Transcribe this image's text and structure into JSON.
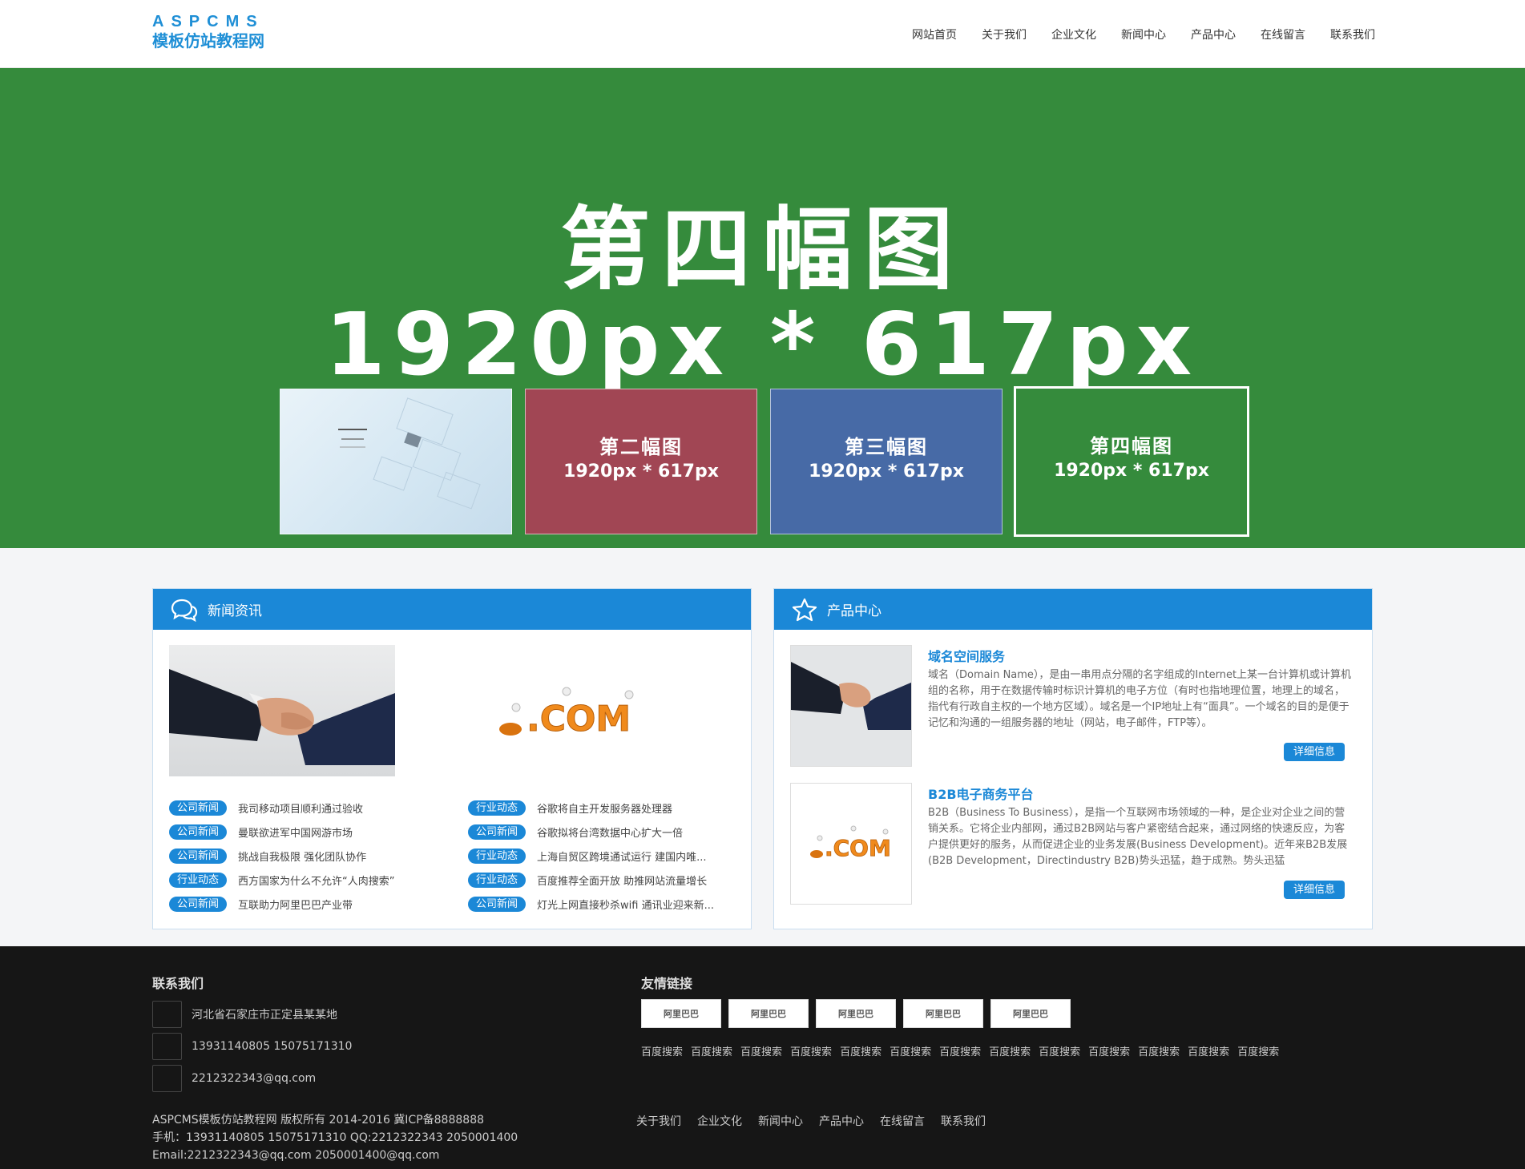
{
  "header": {
    "logo_top": "ASPCMS",
    "logo_bottom": "模板仿站教程网",
    "nav": [
      "网站首页",
      "关于我们",
      "企业文化",
      "新闻中心",
      "产品中心",
      "在线留言",
      "联系我们"
    ]
  },
  "banner": {
    "title": "第四幅图",
    "size": "1920px * 617px",
    "thumbs": [
      {
        "line1": "",
        "line2": "",
        "bg": "#dcebf5"
      },
      {
        "line1": "第二幅图",
        "line2": "1920px * 617px",
        "bg": "#a14654"
      },
      {
        "line1": "第三幅图",
        "line2": "1920px * 617px",
        "bg": "#476aa6"
      },
      {
        "line1": "第四幅图",
        "line2": "1920px * 617px",
        "bg": "#358b3c"
      }
    ]
  },
  "news": {
    "title": "新闻资讯",
    "left": [
      {
        "tag": "公司新闻",
        "title": "我司移动项目顺利通过验收"
      },
      {
        "tag": "公司新闻",
        "title": "曼联欲进军中国网游市场"
      },
      {
        "tag": "公司新闻",
        "title": "挑战自我极限 强化团队协作"
      },
      {
        "tag": "行业动态",
        "title": "西方国家为什么不允许“人肉搜索”"
      },
      {
        "tag": "公司新闻",
        "title": "互联助力阿里巴巴产业带"
      }
    ],
    "right": [
      {
        "tag": "行业动态",
        "title": "谷歌将自主开发服务器处理器"
      },
      {
        "tag": "公司新闻",
        "title": "谷歌拟将台湾数据中心扩大一倍"
      },
      {
        "tag": "行业动态",
        "title": "上海自贸区跨境通试运行 建国内唯..."
      },
      {
        "tag": "行业动态",
        "title": "百度推荐全面开放 助推网站流量增长"
      },
      {
        "tag": "公司新闻",
        "title": "灯光上网直接秒杀wifi 通讯业迎来新..."
      }
    ]
  },
  "products": {
    "title": "产品中心",
    "items": [
      {
        "title": "域名空间服务",
        "desc": "域名（Domain Name），是由一串用点分隔的名字组成的Internet上某一台计算机或计算机组的名称，用于在数据传输时标识计算机的电子方位（有时也指地理位置，地理上的域名，指代有行政自主权的一个地方区域）。域名是一个IP地址上有“面具”。一个域名的目的是便于记忆和沟通的一组服务器的地址（网站，电子邮件，FTP等）。",
        "button": "详细信息"
      },
      {
        "title": "B2B电子商务平台",
        "desc": "B2B（Business To Business），是指一个互联网市场领域的一种，是企业对企业之间的营销关系。它将企业内部网，通过B2B网站与客户紧密结合起来，通过网络的快速反应，为客户提供更好的服务，从而促进企业的业务发展(Business Development)。近年来B2B发展(B2B Development，Directindustry B2B)势头迅猛，趋于成熟。势头迅猛",
        "button": "详细信息"
      }
    ],
    "com_text": ".COM"
  },
  "footer": {
    "contact_title": "联系我们",
    "address": "河北省石家庄市正定县某某地",
    "phone": "13931140805 15075171310",
    "email": "2212322343@qq.com",
    "links_title": "友情链接",
    "link_logo_text": "阿里巴巴",
    "text_links": [
      "百度搜索",
      "百度搜索",
      "百度搜索",
      "百度搜索",
      "百度搜索",
      "百度搜索",
      "百度搜索",
      "百度搜索",
      "百度搜索",
      "百度搜索",
      "百度搜索",
      "百度搜索",
      "百度搜索"
    ],
    "copyright_1": "ASPCMS模板仿站教程网 版权所有 2014-2016 冀ICP备8888888",
    "copyright_2": "手机：13931140805 15075171310 QQ:2212322343 2050001400",
    "copyright_3": "Email:2212322343@qq.com 2050001400@qq.com",
    "nav": [
      "关于我们",
      "企业文化",
      "新闻中心",
      "产品中心",
      "在线留言",
      "联系我们"
    ]
  }
}
